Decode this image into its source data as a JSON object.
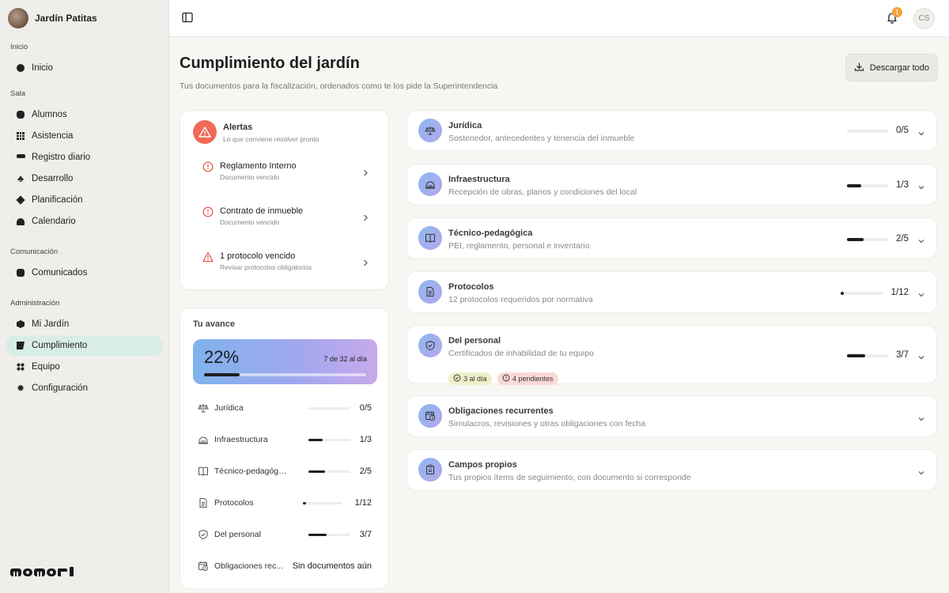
{
  "sidebar": {
    "brand": "Jardín Patitas",
    "sections": {
      "inicio": "Inicio",
      "sala": "Sala",
      "comunicacion": "Comunicación",
      "administracion": "Administración"
    },
    "items": {
      "inicio": "Inicio",
      "alumnos": "Alumnos",
      "asistencia": "Asistencia",
      "registro": "Registro diario",
      "desarrollo": "Desarrollo",
      "planificacion": "Planificación",
      "calendario": "Calendario",
      "comunicados": "Comunicados",
      "mijardin": "Mi Jardín",
      "cumplimiento": "Cumplimiento",
      "equipo": "Equipo",
      "configuracion": "Configuración"
    },
    "logo": "momori"
  },
  "topbar": {
    "notification_count": "1",
    "user_initials": "CS"
  },
  "page": {
    "title": "Cumplimiento del jardín",
    "subtitle": "Tus documentos para la fiscalización, ordenados como te los pide la Superintendencia",
    "download_label": "Descargar todo"
  },
  "alerts": {
    "title": "Alertas",
    "subtitle": "Lo que conviene resolver pronto",
    "items": [
      {
        "title": "Reglamento Interno",
        "sub": "Documento vencido"
      },
      {
        "title": "Contrato de inmueble",
        "sub": "Documento vencido"
      },
      {
        "title": "1 protocolo vencido",
        "sub": "Revisar protocolos obligatorios"
      }
    ]
  },
  "progress": {
    "title": "Tu avance",
    "percent": "22%",
    "percent_value": 0.22,
    "count": "7 de 32 al día",
    "rows": [
      {
        "label": "Jurídica",
        "value": "0/5",
        "fraction": 0
      },
      {
        "label": "Infraestructura",
        "value": "1/3",
        "fraction": 0.333
      },
      {
        "label": "Técnico-pedagógica",
        "value": "2/5",
        "fraction": 0.4
      },
      {
        "label": "Protocolos",
        "value": "1/12",
        "fraction": 0.083
      },
      {
        "label": "Del personal",
        "value": "3/7",
        "fraction": 0.429
      },
      {
        "label": "Obligaciones rec...",
        "value": "Sin documentos aún"
      }
    ]
  },
  "categories": [
    {
      "title": "Jurídica",
      "sub": "Sostenedor, antecedentes y tenencia del inmueble",
      "value": "0/5",
      "fraction": 0,
      "icon": "scale-icon"
    },
    {
      "title": "Infraestructura",
      "sub": "Recepción de obras, planos y condiciones del local",
      "value": "1/3",
      "fraction": 0.333,
      "icon": "building-icon"
    },
    {
      "title": "Técnico-pedagógica",
      "sub": "PEI, reglamento, personal e inventario",
      "value": "2/5",
      "fraction": 0.4,
      "icon": "book-icon"
    },
    {
      "title": "Protocolos",
      "sub": "12 protocolos requeridos por normativa",
      "value": "1/12",
      "fraction": 0.083,
      "icon": "document-icon"
    },
    {
      "title": "Del personal",
      "sub": "Certificados de inhabilidad de tu equipo",
      "value": "3/7",
      "fraction": 0.429,
      "icon": "shield-icon",
      "pill_ok": "3 al día",
      "pill_pending": "4 pendientes"
    },
    {
      "title": "Obligaciones recurrentes",
      "sub": "Simulacros, revisiones y otras obligaciones con fecha",
      "icon": "calendar-clock-icon"
    },
    {
      "title": "Campos propios",
      "sub": "Tus propios ítems de seguimiento, con documento si corresponde",
      "icon": "clipboard-icon"
    }
  ],
  "colors": {
    "accent_active": "#d9ede8",
    "alert": "#ef6b57",
    "badge": "#f2a33a"
  }
}
